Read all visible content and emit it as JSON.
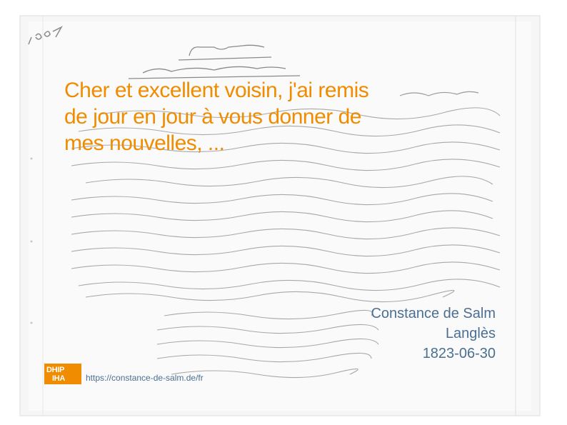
{
  "quote": {
    "text": " Cher et excellent voisin, j'ai remis\nde jour en jour à vous donner de\nmes nouvelles, ..."
  },
  "meta": {
    "author": "Constance de Salm",
    "recipient": "Langlès",
    "date": "1823-06-30"
  },
  "logo": {
    "line1": "DHIP",
    "line2": "IHA"
  },
  "source": {
    "url": "https://constance-de-salm.de/fr"
  },
  "colors": {
    "accent": "#f08c00",
    "meta_text": "#4a6f93",
    "paper": "#f7f7f7",
    "ink": "#9a9a9a"
  },
  "background": {
    "description_icon": "handwritten-letter-image"
  }
}
